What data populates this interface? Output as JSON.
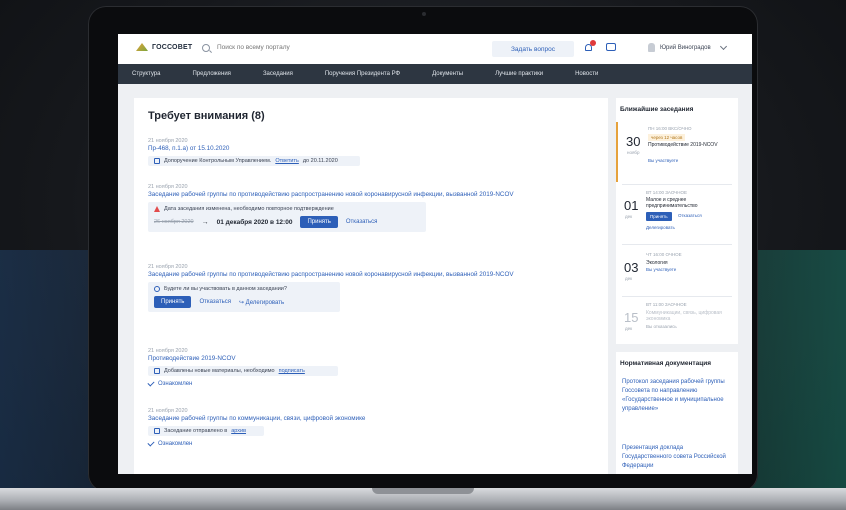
{
  "header": {
    "logo_text": "ГОССОВЕТ",
    "search_placeholder": "Поиск по всему порталу",
    "ask_button": "Задать вопрос",
    "user_name": "Юрий Виноградов"
  },
  "nav": [
    "Структура",
    "Предложения",
    "Заседания",
    "Поручения Президента РФ",
    "Документы",
    "Лучшие практики",
    "Новости"
  ],
  "main": {
    "title": "Требует внимания (8)",
    "items": [
      {
        "date": "21 ноября 2020",
        "title": "Пр-468, п.1.a) от 15.10.2020",
        "note": "Допоручение Контрольным Управлением.",
        "note_link": "Ответить",
        "note_tail": "до 20.11.2020"
      },
      {
        "date": "21 ноября 2020",
        "title": "Заседание рабочей группы по противодействию распространению новой коронавирусной инфекции, вызванной 2019-NCOV",
        "warning": "Дата заседания изменена, необходимо повторное подтверждение",
        "old_date": "26 ноября 2020",
        "new_date": "01 декабря 2020 в 12:00",
        "accept": "Принять",
        "decline": "Отказаться"
      },
      {
        "date": "21 ноября 2020",
        "title": "Заседание рабочей группы по противодействию распространению новой коронавирусной инфекции, вызванной 2019-NCOV",
        "question": "Будете ли вы участвовать в данном заседании?",
        "accept": "Принять",
        "decline": "Отказаться",
        "delegate": "Делегировать"
      },
      {
        "date": "21 ноября 2020",
        "title": "Противодействие 2019-NCOV",
        "note": "Добавлены новые материалы, необходимо",
        "note_link": "подписать",
        "check": "Ознакомлен"
      },
      {
        "date": "21 ноября 2020",
        "title": "Заседание рабочей группы по коммуникации, связи, цифровой экономике",
        "note": "Заседание отправлено в",
        "note_link": "архив",
        "check": "Ознакомлен"
      }
    ]
  },
  "sidebar": {
    "meetings_title": "Ближайшие заседания",
    "meetings": [
      {
        "day": "30",
        "month": "ноябр",
        "time": "ПН  16:00  ВКС/ОЧНО",
        "tag": "через 12 часов",
        "title": "Противодействие 2019-NCOV",
        "sub": "Вы участвуете"
      },
      {
        "day": "01",
        "month": "дек",
        "time": "ВТ  14:00  ЗАОЧНОЕ",
        "title": "Малое и среднее предпринимательство",
        "accept": "Принять",
        "decline": "Отказаться",
        "delegate": "Делегировать"
      },
      {
        "day": "03",
        "month": "дек",
        "time": "ЧТ  16:00  ОЧНОЕ",
        "title": "Экология",
        "sub": "Вы участвуете"
      },
      {
        "day": "15",
        "month": "дек",
        "time": "ВТ  11:00  ЗАОЧНОЕ",
        "title": "Коммуникации, связь, цифровая экономика",
        "sub": "Вы отказались"
      }
    ],
    "docs_title": "Нормативная документация",
    "docs": [
      "Протокол заседания рабочей группы Госсовета по направлению «Государственное и муниципальное управление»",
      "Презентация доклада Государственного совета Российской Федерации"
    ]
  }
}
